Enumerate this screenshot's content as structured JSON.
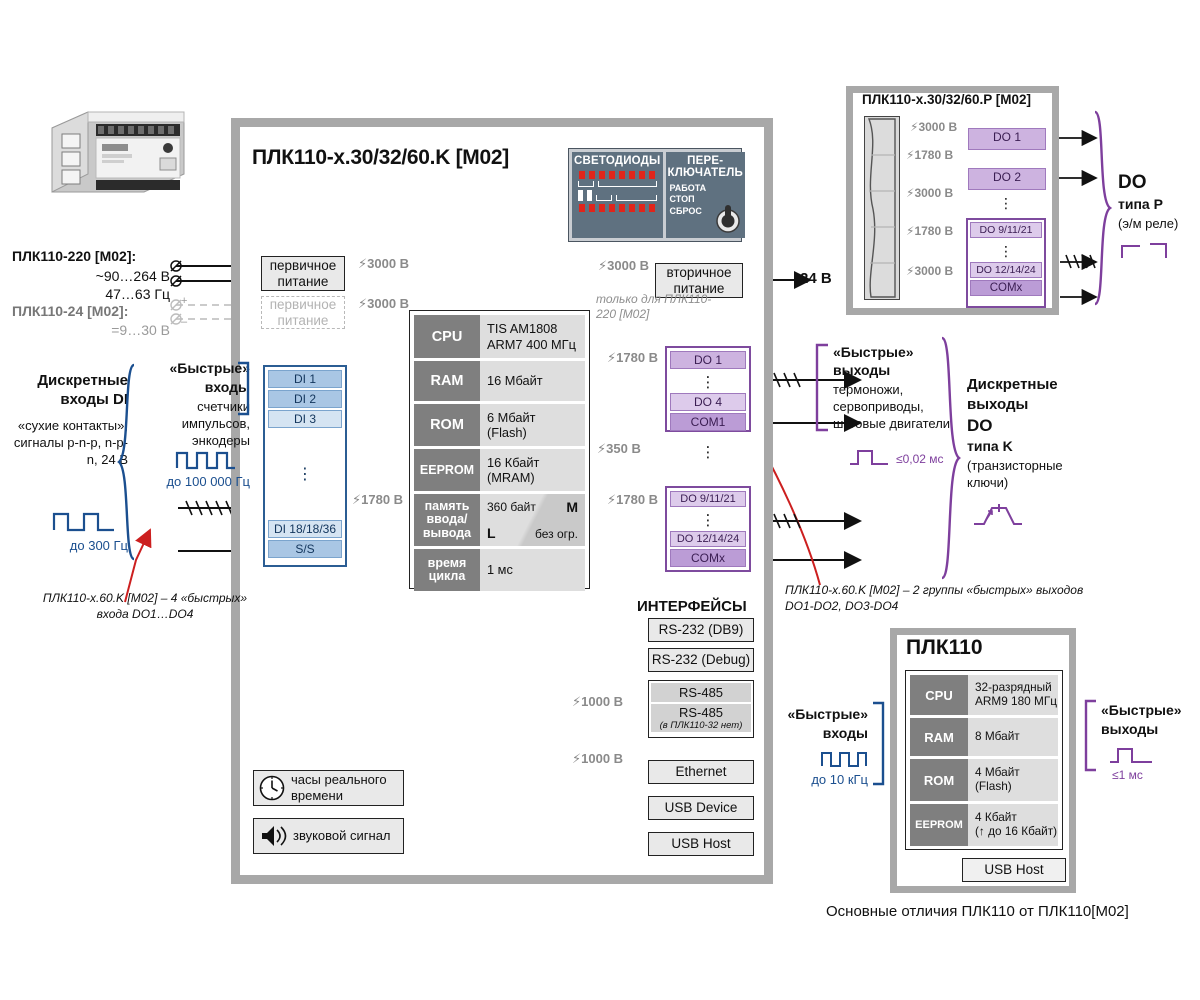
{
  "main": {
    "title": "ПЛК110-x.30/32/60.K [M02]",
    "cpu_table": [
      {
        "key": "CPU",
        "lines": [
          "TIS AM1808",
          "ARM7  400 МГц"
        ]
      },
      {
        "key": "RAM",
        "lines": [
          "16 Мбайт"
        ]
      },
      {
        "key": "ROM",
        "lines": [
          "6 Мбайт",
          "(Flash)"
        ]
      },
      {
        "key": "EEPROM",
        "lines": [
          "16 Кбайт",
          "(MRAM)"
        ]
      },
      {
        "key": "память ввода/вывода",
        "lines": [
          "360 байт",
          "M",
          "L",
          "без огр."
        ]
      },
      {
        "key": "время цикла",
        "lines": [
          "1 мс"
        ]
      }
    ]
  },
  "led_panel": {
    "leds_title": "СВЕТОДИОДЫ",
    "switch_title": "ПЕРЕ-КЛЮЧАТЕЛЬ",
    "switch_modes": [
      "РАБОТА",
      "СТОП",
      "СБРОС"
    ]
  },
  "power": {
    "primary_label": "первичное питание",
    "primary_ghost_label": "первичное питание",
    "secondary_label": "вторичное питание",
    "secondary_out": "24 В",
    "iso_primary_1": "3000 В",
    "iso_primary_2": "3000 В",
    "iso_secondary": "3000 В",
    "secondary_note": "только для ПЛК110-220 [M02]",
    "supply_220_title": "ПЛК110-220 [M02]:",
    "supply_220_l1": "~90…264 В",
    "supply_220_l2": "47…63 Гц",
    "supply_24_title": "ПЛК110-24 [M02]:",
    "supply_24_l1": "=9…30 В",
    "plus": "+",
    "minus": "–"
  },
  "inputs": {
    "title_1": "Дискретные",
    "title_2": "входы DI",
    "desc": "«сухие контакты», сигналы p-n-p, n-p-n, 24 В",
    "slow_rate": "до 300 Гц",
    "fast_title_1": "«Быстрые»",
    "fast_title_2": "входы",
    "fast_desc": "счетчики импульсов, энкодеры",
    "fast_rate": "до 100 000 Гц",
    "note": "ПЛК110-x.60.K [M02] – 4 «быстрых» входа  DO1…DO4",
    "iso": "1780 В",
    "di_cells": [
      "DI 1",
      "DI 2",
      "DI 3",
      "⋮",
      "DI 18/18/36",
      "S/S"
    ]
  },
  "outputs_k": {
    "group1": [
      "DO 1",
      "⋮",
      "DO 4",
      "COM1"
    ],
    "group2": [
      "DO 9/11/21",
      "⋮",
      "DO 12/14/24",
      "COMx"
    ],
    "iso_top": "1780 В",
    "iso_mid": "350 В",
    "iso_bot": "1780 В",
    "fast_title_1": "«Быстрые»",
    "fast_title_2": "выходы",
    "fast_desc": "термоножи, сервоприводы, шаговые двигатели",
    "fast_time": "≤0,02 мс",
    "do_title_1": "Дискретные",
    "do_title_2": "выходы",
    "do_title_3": "DO",
    "do_title_4": "типа K",
    "do_title_5": "(транзисторные ключи)",
    "note": "ПЛК110-x.60.K [M02] – 2 группы «быстрых» выходов DO1-DO2, DO3-DO4"
  },
  "outputs_p": {
    "frame_title": "ПЛК110-x.30/32/60.P [M02]",
    "boxes": [
      "DO 1",
      "DO 2"
    ],
    "group": [
      "DO 9/11/21",
      "⋮",
      "DO 12/14/24",
      "COMx"
    ],
    "dots": "⋮",
    "iso_labels": [
      "3000 В",
      "1780 В",
      "3000 В",
      "1780 В",
      "3000 В"
    ],
    "title_1": "DO",
    "title_2": "типа P",
    "title_3": "(э/м реле)"
  },
  "interfaces": {
    "title": "ИНТЕРФЕЙСЫ",
    "items": [
      {
        "label": "RS-232 (DB9)",
        "sub": ""
      },
      {
        "label": "RS-232 (Debug)",
        "sub": ""
      },
      {
        "label": "RS-485",
        "sub": ""
      },
      {
        "label": "RS-485",
        "sub": "(в ПЛК110-32 нет)"
      },
      {
        "label": "Ethernet",
        "sub": ""
      },
      {
        "label": "USB Device",
        "sub": ""
      },
      {
        "label": "USB Host",
        "sub": ""
      }
    ],
    "iso_485": "1000 В",
    "iso_eth": "1000 В"
  },
  "peripherals": {
    "clock": "часы реального времени",
    "sound": "звуковой сигнал"
  },
  "legacy": {
    "title": "ПЛК110",
    "table": [
      {
        "key": "CPU",
        "lines": [
          "32-разрядный",
          "ARM9  180 МГц"
        ]
      },
      {
        "key": "RAM",
        "lines": [
          "8 Мбайт"
        ]
      },
      {
        "key": "ROM",
        "lines": [
          "4 Мбайт",
          "(Flash)"
        ]
      },
      {
        "key": "EEPROM",
        "lines": [
          "4 Кбайт",
          "(↑ до 16 Кбайт)"
        ]
      }
    ],
    "usb_host": "USB Host",
    "fast_in_1": "«Быстрые»",
    "fast_in_2": "входы",
    "fast_in_rate": "до 10 кГц",
    "fast_out_1": "«Быстрые»",
    "fast_out_2": "выходы",
    "fast_out_time": "≤1 мс",
    "caption": "Основные отличия ПЛК110 от ПЛК110[M02]"
  },
  "colors": {
    "frame_gray": "#a8a8a8",
    "di_blue": "#a9c6e4",
    "do_violet": "#cdb3e0",
    "accent_blue": "#1b4f8f",
    "accent_purple": "#7e3f9d",
    "led_red": "#e1251b",
    "arrow_red": "#cc1f1f"
  }
}
